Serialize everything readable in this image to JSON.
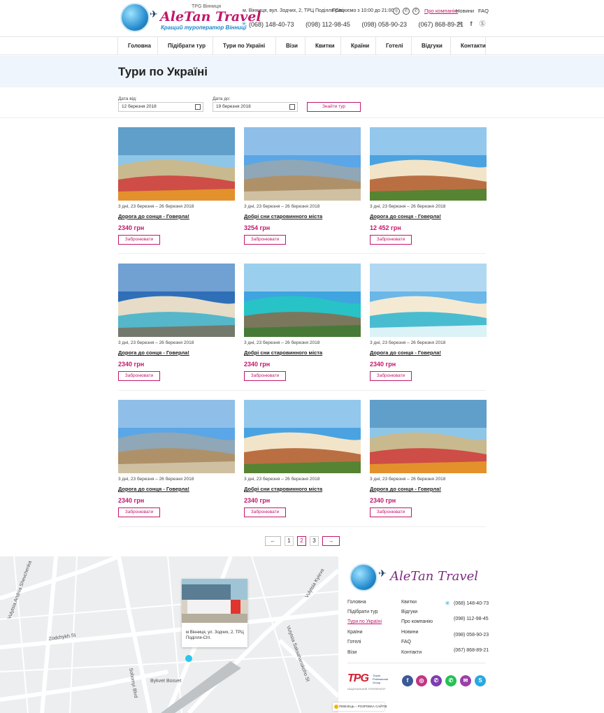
{
  "header": {
    "brand": "AleTan Travel",
    "logo_small": "TPG Вінниця",
    "tagline": "Кращий туроператор Вінниці",
    "address": "м. Вінниця, вул. Зодчих, 2, ТРЦ Поділля-Сіті",
    "hours": "Працюємо з 10:00 до 21:00",
    "links": [
      "Про компанію",
      "Новини",
      "FAQ"
    ],
    "phones": [
      "(068) 148-40-73",
      "(098) 112-98-45",
      "(098) 058-90-23",
      "(067) 868-89-21"
    ]
  },
  "nav": {
    "items": [
      "Головна",
      "Підібрати тур",
      "Тури по Україні",
      "Візи",
      "Квитки",
      "Країни",
      "Готелі",
      "Відгуки",
      "Контакти"
    ]
  },
  "page_title": "Тури по Україні",
  "filter": {
    "from_label": "Дата від:",
    "from_value": "12 березня 2018",
    "to_label": "Дата до:",
    "to_value": "19 березня 2018",
    "button": "Знайти тур"
  },
  "tours": [
    {
      "date": "3 дні, 23 березня – 26 березня 2018",
      "title": "Дорога до сонця - Говерла!",
      "price": "2340 грн",
      "book": "Забронювати"
    },
    {
      "date": "3 дні, 23 березня – 26 березня 2018",
      "title": "Добрі сни старовинного міста",
      "price": "3254 грн",
      "book": "Забронювати"
    },
    {
      "date": "3 дні, 23 березня – 26 березня 2018",
      "title": "Дорога до сонця - Говерла!",
      "price": "12 452 грн",
      "book": "Забронювати"
    },
    {
      "date": "3 дні, 23 березня – 26 березня 2018",
      "title": "Дорога до сонця - Говерла!",
      "price": "2340 грн",
      "book": "Забронювати"
    },
    {
      "date": "3 дні, 23 березня – 26 березня 2018",
      "title": "Добрі сни старовинного міста",
      "price": "2340 грн",
      "book": "Забронювати"
    },
    {
      "date": "3 дні, 23 березня – 26 березня 2018",
      "title": "Дорога до сонця - Говерла!",
      "price": "2340 грн",
      "book": "Забронювати"
    },
    {
      "date": "3 дні, 23 березня – 26 березня 2018",
      "title": "Дорога до сонця - Говерла!",
      "price": "2340 грн",
      "book": "Забронювати"
    },
    {
      "date": "3 дні, 23 березня – 26 березня 2018",
      "title": "Добрі сни старовинного міста",
      "price": "2340 грн",
      "book": "Забронювати"
    },
    {
      "date": "3 дні, 23 березня – 26 березня 2018",
      "title": "Дорога до сонця - Говерла!",
      "price": "2340 грн",
      "book": "Забронювати"
    }
  ],
  "pagination": {
    "prev": "←",
    "pages": [
      "1",
      "2",
      "3"
    ],
    "current": "2",
    "next": "→"
  },
  "map": {
    "address": "м Вінниця, ул. Зодчих, 2, ТРЦ Поділля-Сіті.",
    "streets": [
      "Zodchykh St",
      "Sobornyi Blvd",
      "Vulytsia Kyieva",
      "Vulytsia Andriia Shevchenka",
      "Vulytsia Saksahanskoho St",
      "Bykvet Bosvet"
    ]
  },
  "footer": {
    "brand": "AleTan Travel",
    "col1": [
      "Головна",
      "Підібрати тур",
      "Тури по Україні",
      "Країни",
      "Готелі",
      "Візи"
    ],
    "col2": [
      "Квитки",
      "Відгуки",
      "Про компанію",
      "Новини",
      "FAQ",
      "Контакти"
    ],
    "phones": [
      "(068) 148-40-73",
      "(098) 112-98-45",
      "(098) 058-90-23",
      "(067) 868-89-21"
    ],
    "partner_logo": "TPG",
    "partner_small": "Travel Professional Group",
    "partner_caption": "НАЦІОНАЛЬНИЙ ТУРОПЕРАТОР",
    "developer": "ПЕВНЕЦЬ – РОЗРОБКА САЙТІВ"
  },
  "colors": {
    "accent": "#c2186b",
    "band": "#eef5fc",
    "brand_blue": "#1e88c8"
  }
}
